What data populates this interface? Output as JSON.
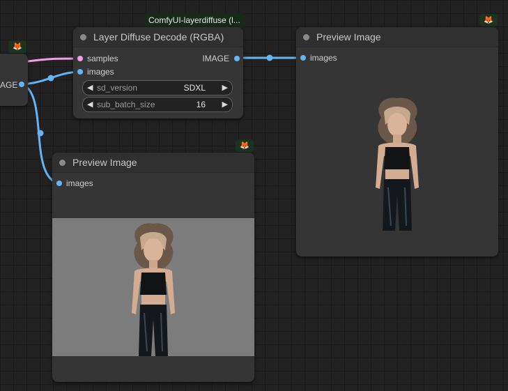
{
  "group_label": "ComfyUI-layerdiffuse (l...",
  "left_node": {
    "output_label": "AGE"
  },
  "decode_node": {
    "title": "Layer Diffuse Decode (RGBA)",
    "inputs": [
      "samples",
      "images"
    ],
    "output_label": "IMAGE",
    "widgets": [
      {
        "name": "sd_version",
        "value": "SDXL"
      },
      {
        "name": "sub_batch_size",
        "value": "16"
      }
    ]
  },
  "preview_right": {
    "title": "Preview Image",
    "input_label": "images"
  },
  "preview_bottom": {
    "title": "Preview Image",
    "input_label": "images"
  },
  "icons": {
    "badge": "fox-icon",
    "arrow_left": "triangle-left-icon",
    "arrow_right": "triangle-right-icon"
  },
  "colors": {
    "image_link": "#64b5f6",
    "latent_link": "#f29ee9",
    "badge_bg": "#1d3320",
    "canvas_bg": "#222222"
  }
}
